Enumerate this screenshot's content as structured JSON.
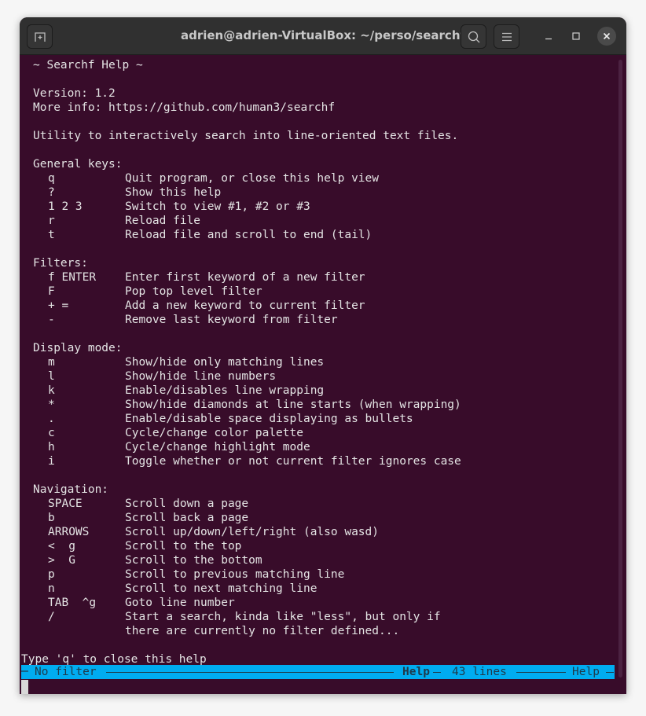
{
  "window": {
    "title": "adrien@adrien-VirtualBox: ~/perso/searchf",
    "buttons": {
      "new_tab": "new-tab-icon",
      "search": "search-icon",
      "menu": "hamburger-menu-icon",
      "minimize": "minimize-icon",
      "maximize": "maximize-icon",
      "close": "close-icon"
    }
  },
  "colors": {
    "terminal_bg": "#380c2a",
    "terminal_fg": "#e4e4e4",
    "titlebar_bg": "#303030",
    "statusbar_bg": "#00acf0",
    "statusbar_fg": "#1f3a4a"
  },
  "help": {
    "header": "~ Searchf Help ~",
    "version": "Version: 1.2",
    "more_info": "More info: https://github.com/human3/searchf",
    "description": "Utility to interactively search into line-oriented text files.",
    "sections": [
      {
        "title": "General keys:",
        "items": [
          {
            "key": "q",
            "desc": "Quit program, or close this help view"
          },
          {
            "key": "?",
            "desc": "Show this help"
          },
          {
            "key": "1 2 3",
            "desc": "Switch to view #1, #2 or #3"
          },
          {
            "key": "r",
            "desc": "Reload file"
          },
          {
            "key": "t",
            "desc": "Reload file and scroll to end (tail)"
          }
        ]
      },
      {
        "title": "Filters:",
        "items": [
          {
            "key": "f ENTER",
            "desc": "Enter first keyword of a new filter"
          },
          {
            "key": "F",
            "desc": "Pop top level filter"
          },
          {
            "key": "+ =",
            "desc": "Add a new keyword to current filter"
          },
          {
            "key": "-",
            "desc": "Remove last keyword from filter"
          }
        ]
      },
      {
        "title": "Display mode:",
        "items": [
          {
            "key": "m",
            "desc": "Show/hide only matching lines"
          },
          {
            "key": "l",
            "desc": "Show/hide line numbers"
          },
          {
            "key": "k",
            "desc": "Enable/disables line wrapping"
          },
          {
            "key": "*",
            "desc": "Show/hide diamonds at line starts (when wrapping)"
          },
          {
            "key": ".",
            "desc": "Enable/disable space displaying as bullets"
          },
          {
            "key": "c",
            "desc": "Cycle/change color palette"
          },
          {
            "key": "h",
            "desc": "Cycle/change highlight mode"
          },
          {
            "key": "i",
            "desc": "Toggle whether or not current filter ignores case"
          }
        ]
      },
      {
        "title": "Navigation:",
        "items": [
          {
            "key": "SPACE",
            "desc": "Scroll down a page"
          },
          {
            "key": "b",
            "desc": "Scroll back a page"
          },
          {
            "key": "ARROWS",
            "desc": "Scroll up/down/left/right (also wasd)"
          },
          {
            "key": "<  g",
            "desc": "Scroll to the top"
          },
          {
            "key": ">  G",
            "desc": "Scroll to the bottom"
          },
          {
            "key": "p",
            "desc": "Scroll to previous matching line"
          },
          {
            "key": "n",
            "desc": "Scroll to next matching line"
          },
          {
            "key": "TAB  ^g",
            "desc": "Goto line number"
          },
          {
            "key": "/",
            "desc": "Start a search, kinda like \"less\", but only if"
          },
          {
            "key": "",
            "desc": "there are currently no filter defined..."
          }
        ]
      }
    ],
    "footer": "Type 'q' to close this help"
  },
  "statusbar": {
    "filter": "No filter",
    "view_name": "Help",
    "line_count": "43 lines",
    "right_label": "Help"
  }
}
